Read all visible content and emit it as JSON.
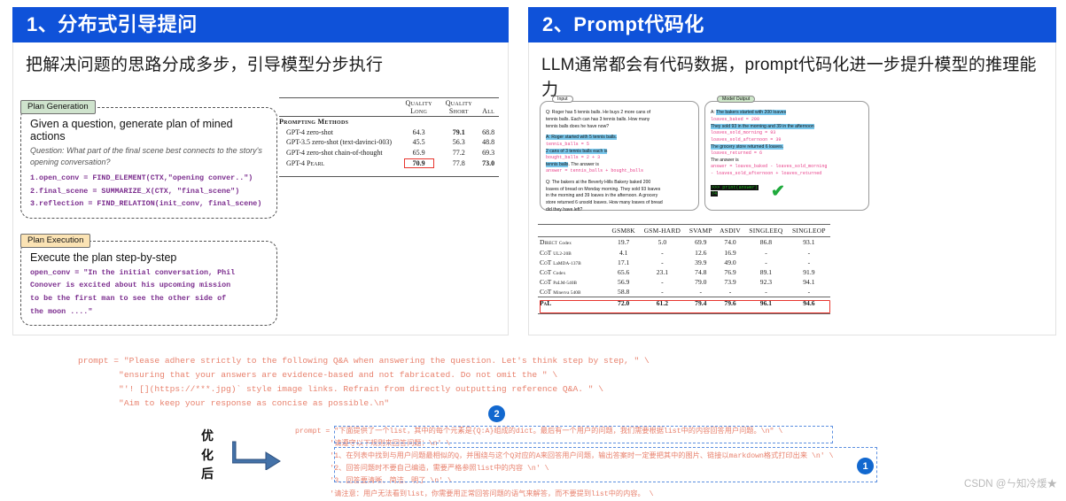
{
  "panels": [
    {
      "header": "1、分布式引导提问",
      "subtitle": "把解决问题的思路分成多步，引导模型分步执行",
      "figure": {
        "plan_generation": {
          "tag": "Plan Generation",
          "title": "Given a question, generate plan of mined actions",
          "question": "Question: What part of the final scene best connects to the story's opening conversation?",
          "code": [
            "1.open_conv = FIND_ELEMENT(CTX,\"opening conver..\")",
            "2.final_scene = SUMMARIZE_X(CTX, \"final_scene\")",
            "3.reflection = FIND_RELATION(init_conv, final_scene)"
          ]
        },
        "plan_execution": {
          "tag": "Plan Execution",
          "title": "Execute the plan step-by-step",
          "code": [
            "open_conv = \"In the initial conversation, Phil",
            "Conover is excited about his upcoming mission",
            "to be the first man to see the other side of",
            "the moon ....\""
          ]
        }
      },
      "table": {
        "headers": [
          "",
          "Quality Long",
          "Quality Short",
          "All"
        ],
        "header_lines": [
          [
            "Quality",
            "Long"
          ],
          [
            "Quality",
            "Short"
          ],
          [
            "All",
            ""
          ]
        ],
        "group": "Prompting Methods",
        "rows": [
          {
            "label": "GPT-4 zero-shot",
            "values": [
              "64.3",
              "79.1",
              "68.8"
            ],
            "bold": [
              false,
              true,
              false
            ],
            "boxed": [
              false,
              false,
              false
            ]
          },
          {
            "label": "GPT-3.5 zero-shot (text-davinci-003)",
            "values": [
              "45.5",
              "56.3",
              "48.8"
            ],
            "bold": [
              false,
              false,
              false
            ],
            "boxed": [
              false,
              false,
              false
            ]
          },
          {
            "label": "GPT-4 zero-shot chain-of-thought",
            "values": [
              "65.9",
              "77.2",
              "69.3"
            ],
            "bold": [
              false,
              false,
              false
            ],
            "boxed": [
              false,
              false,
              false
            ]
          },
          {
            "label": "GPT-4 Pearl",
            "values": [
              "70.9",
              "77.8",
              "73.0"
            ],
            "bold": [
              true,
              false,
              true
            ],
            "boxed": [
              true,
              false,
              false
            ]
          }
        ]
      }
    },
    {
      "header": "2、Prompt代码化",
      "subtitle": "LLM通常都会有代码数据，prompt代码化进一步提升模型的推理能力",
      "figure": {
        "input": {
          "label": "Input",
          "lines": [
            {
              "t": "Q: Roger has 5 tennis balls. He buys 2 more cans of",
              "s": "plain"
            },
            {
              "t": "tennis balls. Each can has 3 tennis balls. How many",
              "s": "plain"
            },
            {
              "t": "tennis balls does he have now?",
              "s": "plain"
            },
            {
              "t": "",
              "s": "plain"
            },
            {
              "t": "A: Roger started with 5 tennis balls.",
              "s": "hl"
            },
            {
              "t": "tennis_balls = 5",
              "s": "code"
            },
            {
              "t": "2 cans of 3 tennis balls each is",
              "s": "hl"
            },
            {
              "t": "bought_balls = 2 + 3",
              "s": "code"
            },
            {
              "t": "tennis balls. The answer is",
              "s": "mix"
            },
            {
              "t": "answer = tennis_balls + bought_balls",
              "s": "code"
            },
            {
              "t": "",
              "s": "plain"
            },
            {
              "t": "Q: The bakers at the Beverly Hills Bakery baked 200",
              "s": "plain"
            },
            {
              "t": "loaves of bread on Monday morning. They sold 93 loaves",
              "s": "plain"
            },
            {
              "t": "in the morning and 39 loaves in the afternoon. A grocery",
              "s": "plain"
            },
            {
              "t": "store returned 6 unsold loaves. How many loaves of bread",
              "s": "plain"
            },
            {
              "t": "did they have left?",
              "s": "plain"
            }
          ]
        },
        "model_output": {
          "label": "Model Output",
          "lines": [
            {
              "t": "A: The bakers started with 200 loaves",
              "s": "hl"
            },
            {
              "t": "loaves_baked = 200",
              "s": "code"
            },
            {
              "t": "They sold 93 in the morning and 39 in the afternoon",
              "s": "hl"
            },
            {
              "t": "loaves_sold_morning = 93",
              "s": "code"
            },
            {
              "t": "loaves_sold_afternoon = 39",
              "s": "code"
            },
            {
              "t": "The grocery store returned 6 loaves.",
              "s": "hl"
            },
            {
              "t": "loaves_returned = 6",
              "s": "code"
            },
            {
              "t": "The answer is",
              "s": "plain"
            },
            {
              "t": "answer = loaves_baked - loaves_sold_morning",
              "s": "code"
            },
            {
              "t": "  - loaves_sold_afternoon + loaves_returned",
              "s": "code"
            }
          ],
          "terminal": [
            ">>> print(answer)",
            "74"
          ],
          "check": "✔"
        }
      },
      "table": {
        "headers": [
          "",
          "GSM8K",
          "GSM-HARD",
          "SVAMP",
          "ASDIV",
          "SINGLEEQ",
          "SINGLEOP"
        ],
        "rows": [
          {
            "label": "Direct",
            "sub": "Codex",
            "values": [
              "19.7",
              "5.0",
              "69.9",
              "74.0",
              "86.8",
              "93.1"
            ]
          },
          {
            "label": "CoT",
            "sub": "UL2-20B",
            "values": [
              "4.1",
              "-",
              "12.6",
              "16.9",
              "-",
              "-"
            ]
          },
          {
            "label": "CoT",
            "sub": "LaMDA-137B",
            "values": [
              "17.1",
              "-",
              "39.9",
              "49.0",
              "-",
              "-"
            ]
          },
          {
            "label": "CoT",
            "sub": "Codex",
            "values": [
              "65.6",
              "23.1",
              "74.8",
              "76.9",
              "89.1",
              "91.9"
            ]
          },
          {
            "label": "CoT",
            "sub": "PaLM-540B",
            "values": [
              "56.9",
              "-",
              "79.0",
              "73.9",
              "92.3",
              "94.1"
            ]
          },
          {
            "label": "CoT",
            "sub": "Minerva 540B",
            "values": [
              "58.8",
              "-",
              "-",
              "-",
              "-",
              "-"
            ]
          },
          {
            "label": "PaL",
            "sub": "",
            "values": [
              "72.0",
              "61.2",
              "79.4",
              "79.6",
              "96.1",
              "94.6"
            ],
            "highlight": true
          }
        ]
      }
    }
  ],
  "bottom": {
    "prompt_before": [
      "prompt = \"Please adhere strictly to the following Q&A when answering the question. Let's think step by step, \" \\",
      "        \"ensuring that your answers are evidence-based and not fabricated. Do not omit the \" \\",
      "        \"'! [](https://***.jpg)` style image links. Refrain from directly outputting reference Q&A. \" \\",
      "        \"Aim to keep your response as concise as possible.\\n\""
    ],
    "optimized_label": [
      "优",
      "化",
      "后"
    ],
    "prompt_after": [
      "prompt = \"下面提供了一个list，其中的每个元素是{Q:A}组成的dict。最后有一个用户的问题，我们需要根据list中的内容回答用户问题。\\n\" \\",
      "        '请遵守以下规则来回答问题：\\n' \\",
      "        '1、在列表中找到与用户问题最相似的Q，并围绕与这个Q对应的A来回答用户问题，输出答案时一定要把其中的图片、链接以markdown格式打印出来 \\n' \\",
      "        '2、回答问题时不要自己编造，需要严格参照list中的内容 \\n' \\",
      "        '3、回答要清晰、简洁、明了 \\n' \\",
      "        '请注意：用户无法看到list，你需要用正常回答问题的语气来解答，而不要提到list中的内容。 \\"
    ],
    "badge_2": "2",
    "badge_1": "1"
  },
  "watermark": "CSDN @ㄣ知冷煖★"
}
